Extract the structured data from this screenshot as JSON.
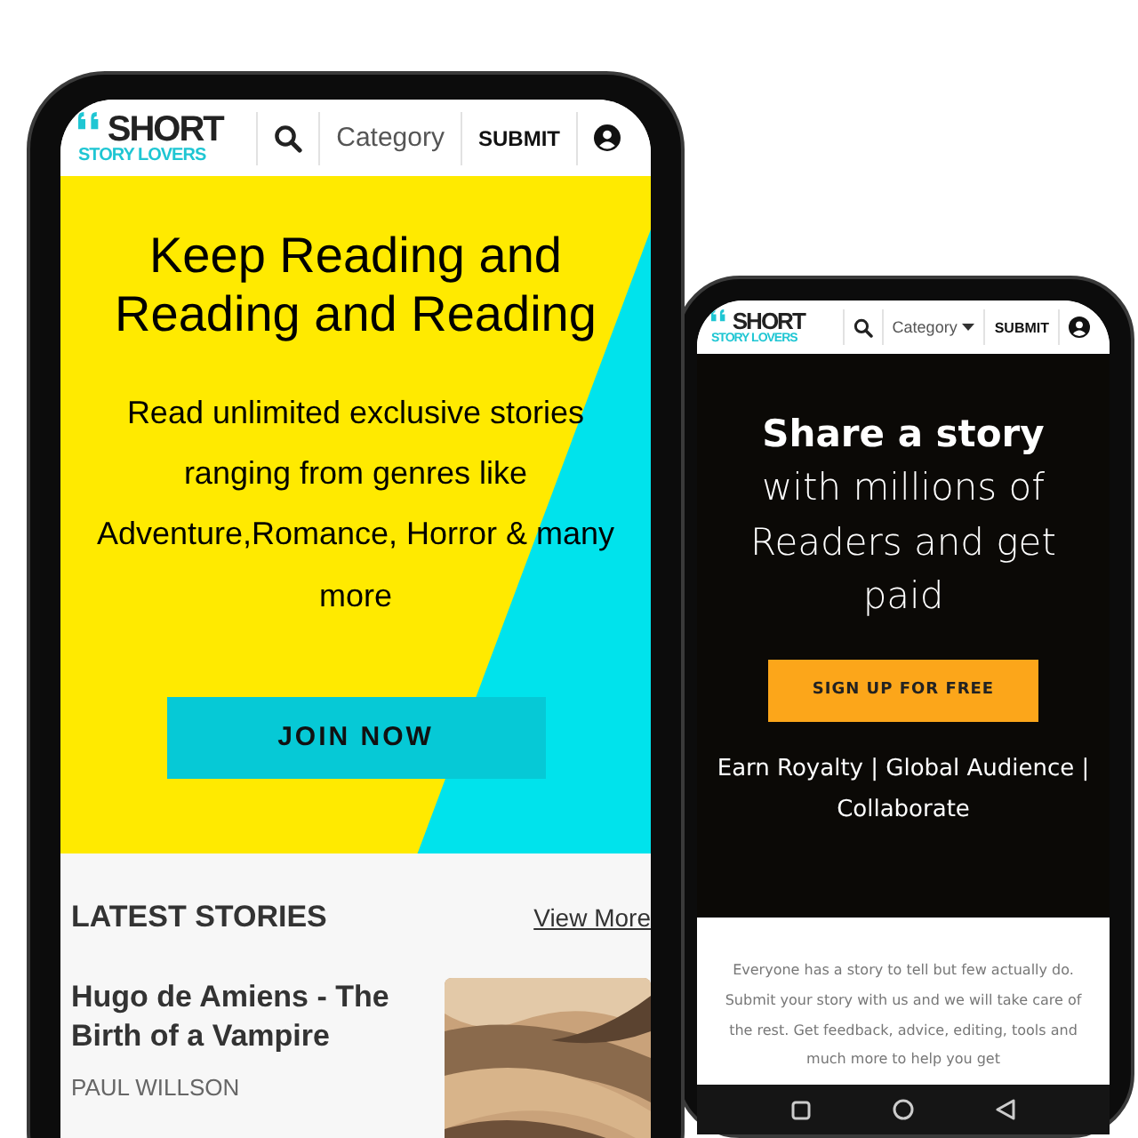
{
  "left_phone": {
    "header": {
      "logo_top": "SHORT",
      "logo_bottom": "STORY LOVERS",
      "category": "Category",
      "submit": "SUBMIT"
    },
    "hero": {
      "title": "Keep Reading and Reading and Reading",
      "subtitle": "Read unlimited exclusive stories ranging from genres like Adventure,Romance, Horror & many more",
      "button": "JOIN NOW"
    },
    "latest": {
      "heading": "LATEST STORIES",
      "link": "View More",
      "stories": [
        {
          "title": "Hugo de Amiens - The Birth of a Vampire",
          "author": "PAUL WILLSON"
        }
      ]
    }
  },
  "right_phone": {
    "header": {
      "logo_top": "SHORT",
      "logo_bottom": "STORY LOVERS",
      "category": "Category",
      "submit": "SUBMIT"
    },
    "hero": {
      "title": "**Share a story** with millions of Readers and get paid",
      "button": "SIGN UP FOR FREE",
      "features": "Earn Royalty | Global Audience | Collaborate"
    },
    "intro": "Everyone has a story to tell but few actually do. Submit your story with us and we will take care of the rest. Get feedback, advice, editing, tools and much more to help you get"
  }
}
